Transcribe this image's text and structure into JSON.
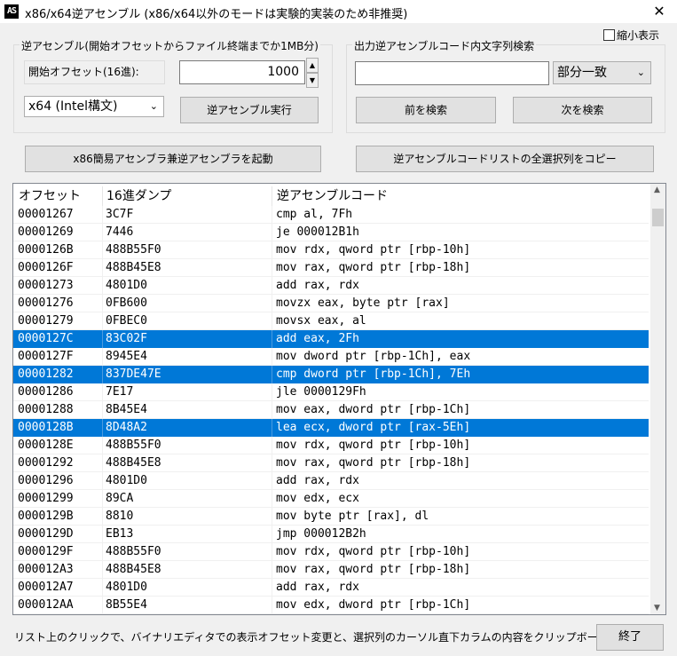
{
  "window": {
    "icon_label": "AS",
    "title": "x86/x64逆アセンブル (x86/x64以外のモードは実験的実装のため非推奨)",
    "close_glyph": "✕"
  },
  "options": {
    "compact_label": "縮小表示",
    "compact_checked": false
  },
  "disasm_group": {
    "legend": "逆アセンブル(開始オフセットからファイル終端までか1MB分)",
    "offset_label": "開始オフセット(16進):",
    "offset_value": "1000",
    "mode_selected": "x64 (Intel構文)",
    "run_button": "逆アセンブル実行"
  },
  "search_group": {
    "legend": "出力逆アセンブルコード内文字列検索",
    "query_value": "",
    "match_selected": "部分一致",
    "prev_button": "前を検索",
    "next_button": "次を検索"
  },
  "actions": {
    "launch_assembler": "x86簡易アセンブラ兼逆アセンブラを起動",
    "copy_selected": "逆アセンブルコードリストの全選択列をコピー"
  },
  "list": {
    "columns": [
      "オフセット",
      "16進ダンプ",
      "逆アセンブルコード"
    ],
    "rows": [
      {
        "offset": "00001267",
        "hex": "3C7F",
        "code": "cmp al, 7Fh",
        "selected": false
      },
      {
        "offset": "00001269",
        "hex": "7446",
        "code": "je 000012B1h",
        "selected": false
      },
      {
        "offset": "0000126B",
        "hex": "488B55F0",
        "code": "mov rdx, qword ptr [rbp-10h]",
        "selected": false
      },
      {
        "offset": "0000126F",
        "hex": "488B45E8",
        "code": "mov rax, qword ptr [rbp-18h]",
        "selected": false
      },
      {
        "offset": "00001273",
        "hex": "4801D0",
        "code": "add rax, rdx",
        "selected": false
      },
      {
        "offset": "00001276",
        "hex": "0FB600",
        "code": "movzx eax, byte ptr [rax]",
        "selected": false
      },
      {
        "offset": "00001279",
        "hex": "0FBEC0",
        "code": "movsx eax, al",
        "selected": false
      },
      {
        "offset": "0000127C",
        "hex": "83C02F",
        "code": "add eax, 2Fh",
        "selected": true
      },
      {
        "offset": "0000127F",
        "hex": "8945E4",
        "code": "mov dword ptr [rbp-1Ch], eax",
        "selected": false
      },
      {
        "offset": "00001282",
        "hex": "837DE47E",
        "code": "cmp dword ptr [rbp-1Ch], 7Eh",
        "selected": true
      },
      {
        "offset": "00001286",
        "hex": "7E17",
        "code": "jle 0000129Fh",
        "selected": false
      },
      {
        "offset": "00001288",
        "hex": "8B45E4",
        "code": "mov eax, dword ptr [rbp-1Ch]",
        "selected": false
      },
      {
        "offset": "0000128B",
        "hex": "8D48A2",
        "code": "lea ecx, dword ptr [rax-5Eh]",
        "selected": true
      },
      {
        "offset": "0000128E",
        "hex": "488B55F0",
        "code": "mov rdx, qword ptr [rbp-10h]",
        "selected": false
      },
      {
        "offset": "00001292",
        "hex": "488B45E8",
        "code": "mov rax, qword ptr [rbp-18h]",
        "selected": false
      },
      {
        "offset": "00001296",
        "hex": "4801D0",
        "code": "add rax, rdx",
        "selected": false
      },
      {
        "offset": "00001299",
        "hex": "89CA",
        "code": "mov edx, ecx",
        "selected": false
      },
      {
        "offset": "0000129B",
        "hex": "8810",
        "code": "mov byte ptr [rax], dl",
        "selected": false
      },
      {
        "offset": "0000129D",
        "hex": "EB13",
        "code": "jmp 000012B2h",
        "selected": false
      },
      {
        "offset": "0000129F",
        "hex": "488B55F0",
        "code": "mov rdx, qword ptr [rbp-10h]",
        "selected": false
      },
      {
        "offset": "000012A3",
        "hex": "488B45E8",
        "code": "mov rax, qword ptr [rbp-18h]",
        "selected": false
      },
      {
        "offset": "000012A7",
        "hex": "4801D0",
        "code": "add rax, rdx",
        "selected": false
      },
      {
        "offset": "000012AA",
        "hex": "8B55E4",
        "code": "mov edx, dword ptr [rbp-1Ch]",
        "selected": false
      }
    ]
  },
  "status": {
    "hint": "リスト上のクリックで、バイナリエディタでの表示オフセット変更と、選択列のカーソル直下カラムの内容をクリップボードにコピー",
    "exit_button": "終了"
  }
}
